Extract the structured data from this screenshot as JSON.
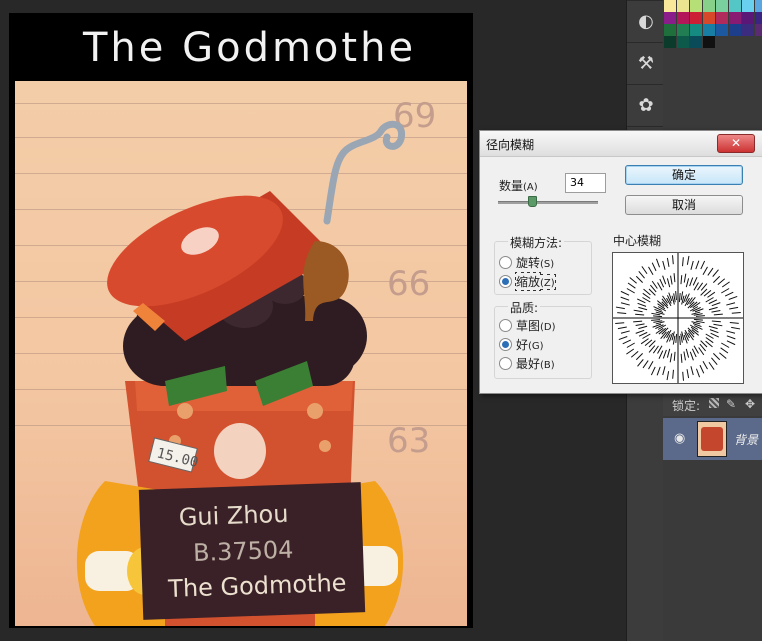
{
  "document": {
    "title": "The Godmothe",
    "height_marks": [
      "69",
      "66",
      "63"
    ],
    "sign": {
      "line1": "Gui Zhou",
      "line2": "B.37504",
      "line3": "The Godmothe"
    },
    "price_tag": "15.00"
  },
  "right_toolbar": {
    "icons": [
      "adjustment-icon",
      "brush-preset-icon",
      "palette-icon"
    ]
  },
  "swatches": [
    [
      "#f9e79a",
      "#eae38f",
      "#b7df77",
      "#86d08a",
      "#79cf9d",
      "#55c6c6",
      "#69d1ef",
      "#5aa7e1",
      "#4a6ec3",
      "#3a43b1"
    ],
    [
      "#8b1d8b",
      "#b3175a",
      "#cc1e34",
      "#d7472a",
      "#b12a5c",
      "#8a1b73",
      "#5a1777",
      "#3a2484",
      "#223a90",
      "#2b5ba6"
    ],
    [
      "#1f6f3c",
      "#217d52",
      "#158a80",
      "#187ea4",
      "#1b58a0",
      "#1d3e8a",
      "#3c2c7f",
      "#5a2a73",
      "#6f2a4f",
      "#7a3b2a"
    ],
    [
      "#0a3b2b",
      "#0d5a4a",
      "#0a4b5a",
      "#111111"
    ]
  ],
  "layers_panel": {
    "lock_label": "锁定:",
    "layer_name": "背景"
  },
  "dialog": {
    "title": "径向模糊",
    "close_label": "✕",
    "amount_label": "数量",
    "amount_hotkey": "(A)",
    "amount_value": "34",
    "amount_fraction": 0.34,
    "ok_label": "确定",
    "cancel_label": "取消",
    "blur_method_label": "模糊方法:",
    "spin_label": "旋转",
    "spin_hotkey": "(S)",
    "zoom_label": "缩放",
    "zoom_hotkey": "(Z)",
    "quality_label": "品质:",
    "draft_label": "草图",
    "draft_hotkey": "(D)",
    "good_label": "好",
    "good_hotkey": "(G)",
    "best_label": "最好",
    "best_hotkey": "(B)",
    "center_label": "中心模糊"
  }
}
